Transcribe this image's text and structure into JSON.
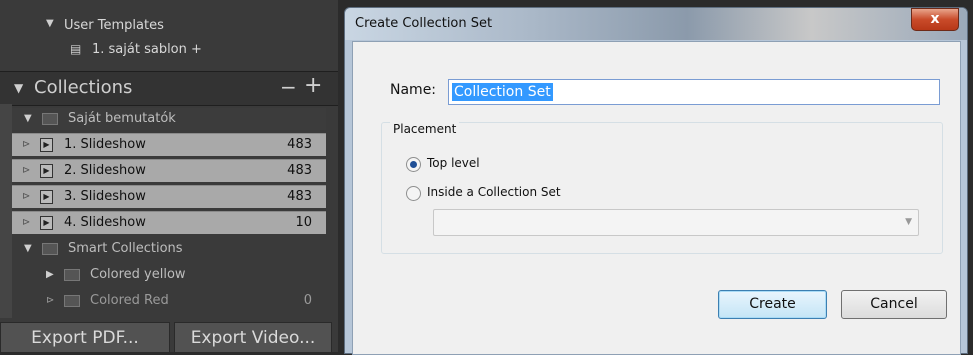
{
  "panel": {
    "user_templates": "User Templates",
    "template_item": "1. saját sablon +",
    "collections_title": "Collections",
    "collections_minus": "−",
    "collections_plus": "+",
    "set_name": "Saját bemutatók",
    "slideshows": [
      {
        "label": "1. Slideshow",
        "count": "483"
      },
      {
        "label": "2. Slideshow",
        "count": "483"
      },
      {
        "label": "3. Slideshow",
        "count": "483"
      },
      {
        "label": "4. Slideshow",
        "count": "10"
      }
    ],
    "smart_collections": "Smart Collections",
    "smart_items": [
      {
        "label": "Colored yellow",
        "count": ""
      },
      {
        "label": "Colored Red",
        "count": "0"
      }
    ],
    "export_pdf": "Export PDF...",
    "export_video": "Export Video..."
  },
  "dialog": {
    "title": "Create Collection Set",
    "close": "x",
    "name_label": "Name:",
    "name_value": "Collection Set",
    "placement_legend": "Placement",
    "option_top": "Top level",
    "option_inside": "Inside a Collection Set",
    "selected_option": "Top level",
    "create_label": "Create",
    "cancel_label": "Cancel"
  }
}
